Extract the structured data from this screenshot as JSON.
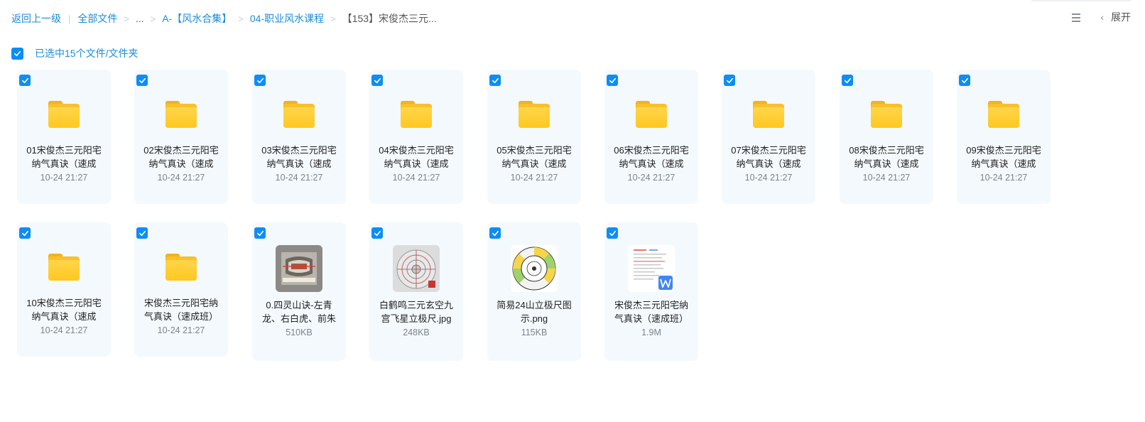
{
  "breadcrumb": {
    "back": "返回上一级",
    "all": "全部文件",
    "ellipsis": "...",
    "level1": "A-【风水合集】",
    "level2": "04-职业风水课程",
    "current": "【153】宋俊杰三元..."
  },
  "toolbar": {
    "expand_label": "展开"
  },
  "selection": {
    "label": "已选中15个文件/文件夹",
    "checked": true
  },
  "items": [
    {
      "name": "01宋俊杰三元阳宅纳气真诀（速成",
      "meta": "10-24 21:27",
      "type": "folder",
      "checked": true
    },
    {
      "name": "02宋俊杰三元阳宅纳气真诀（速成",
      "meta": "10-24 21:27",
      "type": "folder",
      "checked": true
    },
    {
      "name": "03宋俊杰三元阳宅纳气真诀（速成",
      "meta": "10-24 21:27",
      "type": "folder",
      "checked": true
    },
    {
      "name": "04宋俊杰三元阳宅纳气真诀（速成",
      "meta": "10-24 21:27",
      "type": "folder",
      "checked": true
    },
    {
      "name": "05宋俊杰三元阳宅纳气真诀（速成",
      "meta": "10-24 21:27",
      "type": "folder",
      "checked": true
    },
    {
      "name": "06宋俊杰三元阳宅纳气真诀（速成",
      "meta": "10-24 21:27",
      "type": "folder",
      "checked": true
    },
    {
      "name": "07宋俊杰三元阳宅纳气真诀（速成",
      "meta": "10-24 21:27",
      "type": "folder",
      "checked": true
    },
    {
      "name": "08宋俊杰三元阳宅纳气真诀（速成",
      "meta": "10-24 21:27",
      "type": "folder",
      "checked": true
    },
    {
      "name": "09宋俊杰三元阳宅纳气真诀（速成",
      "meta": "10-24 21:27",
      "type": "folder",
      "checked": true
    },
    {
      "name": "10宋俊杰三元阳宅纳气真诀（速成",
      "meta": "10-24 21:27",
      "type": "folder",
      "checked": true
    },
    {
      "name": "宋俊杰三元阳宅纳气真诀（速成班）",
      "meta": "10-24 21:27",
      "type": "folder",
      "checked": true
    },
    {
      "name": "0.四灵山诀-左青龙、右白虎、前朱",
      "meta": "510KB",
      "type": "image-diagram",
      "checked": true
    },
    {
      "name": "白鹤鸣三元玄空九宫飞星立极尺.jpg",
      "meta": "248KB",
      "type": "image-compass",
      "checked": true
    },
    {
      "name": "简易24山立极尺图示.png",
      "meta": "115KB",
      "type": "image-wheel",
      "checked": true
    },
    {
      "name": "宋俊杰三元阳宅纳气真诀（速成班）",
      "meta": "1.9M",
      "type": "doc-word",
      "checked": true
    }
  ],
  "colors": {
    "accent": "#0d8df5",
    "link": "#1a8cd8",
    "folder": "#ffc81f",
    "tile_bg": "#f4f9fd"
  }
}
